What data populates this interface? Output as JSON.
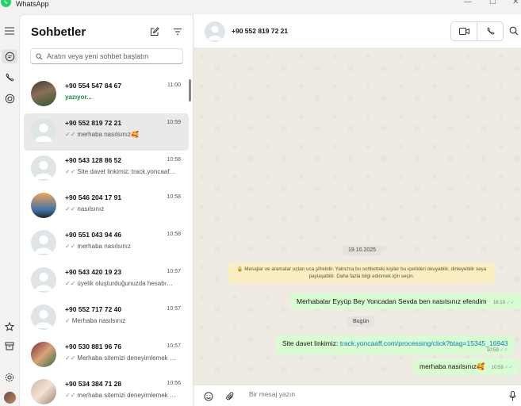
{
  "window": {
    "title": "WhatsApp",
    "controls": [
      "minimize",
      "maximize",
      "close"
    ]
  },
  "rail": {
    "top_icons": [
      "menu-icon",
      "chats-icon",
      "calls-icon",
      "status-icon"
    ],
    "bottom_icons": [
      "starred-icon",
      "archive-icon",
      "settings-icon",
      "profile-avatar"
    ]
  },
  "sidebar": {
    "title": "Sohbetler",
    "search_placeholder": "Aratın veya yeni sohbet başlatın",
    "chats": [
      {
        "name": "+90 554 547 84 67",
        "time": "11:00",
        "preview": "yazıyor...",
        "typing": true,
        "has_photo": true,
        "selected": false
      },
      {
        "name": "+90 552 819 72 21",
        "time": "10:59",
        "preview": "merhaba nasılsınız🥰",
        "ticks": "✓✓",
        "has_photo": false,
        "selected": true
      },
      {
        "name": "+90 543 128 86 52",
        "time": "10:58",
        "preview": "Site davet linkimiz: track.yoncaaff.com/processing/click?btag=15345",
        "ticks": "✓✓",
        "has_photo": false,
        "selected": false
      },
      {
        "name": "+90 546 204 17 91",
        "time": "10:58",
        "preview": "nasılsınız",
        "ticks": "✓✓",
        "has_photo": true,
        "selected": false
      },
      {
        "name": "+90 551 043 94 46",
        "time": "10:58",
        "preview": "merhaba nasılsınız",
        "ticks": "✓✓",
        "has_photo": false,
        "selected": false
      },
      {
        "name": "+90 543 420 19 23",
        "time": "10:57",
        "preview": "üyelik oluşturduğunuzda hesabınıza",
        "ticks": "✓✓",
        "has_photo": false,
        "selected": false
      },
      {
        "name": "+90 552 717 72 40",
        "time": "10:57",
        "preview": "Merhaba nasılsınız",
        "ticks": "✓",
        "has_photo": false,
        "selected": false
      },
      {
        "name": "+90 530 881 96 76",
        "time": "10:57",
        "preview": "Merhaba sitemizi deneyimlemek ister misiniz",
        "ticks": "✓✓",
        "has_photo": true,
        "selected": false
      },
      {
        "name": "+90 534 384 71 28",
        "time": "10:56",
        "preview": "merhaba sitemizi deneyimlemek ister misiniz",
        "ticks": "✓✓",
        "has_photo": true,
        "selected": false
      }
    ]
  },
  "chat": {
    "contact_name": "+90 552 819 72 21",
    "date_chip": "19.10.2025",
    "encryption_note": "🔒 Mesajlar ve aramalar uçtan uca şifrelidir. Yalnızca bu sohbetteki kişiler bu içerikleri okuyabilir, dinleyebilir veya paylaşabilir. Daha fazla bilgi edinmek için seçin.",
    "today_chip": "Bugün",
    "messages": [
      {
        "text": "Merhabalar Eyyüp Bey Yoncadan Sevda ben nasılsınız efendim",
        "time": "16:19"
      },
      {
        "text_prefix": "Site davet linkimiz: ",
        "link": "track.yoncaaff.com/processing/click?btag=15345_16943",
        "time": "10:59"
      },
      {
        "text": "merhaba nasılsınız🥰",
        "time": "10:59"
      }
    ],
    "composer_placeholder": "Bir mesaj yazın"
  },
  "colors": {
    "accent_green": "#1b8a43",
    "bubble_out": "#d9fdd3",
    "wallpaper": "#efeae2",
    "read_tick": "#53bdeb"
  }
}
